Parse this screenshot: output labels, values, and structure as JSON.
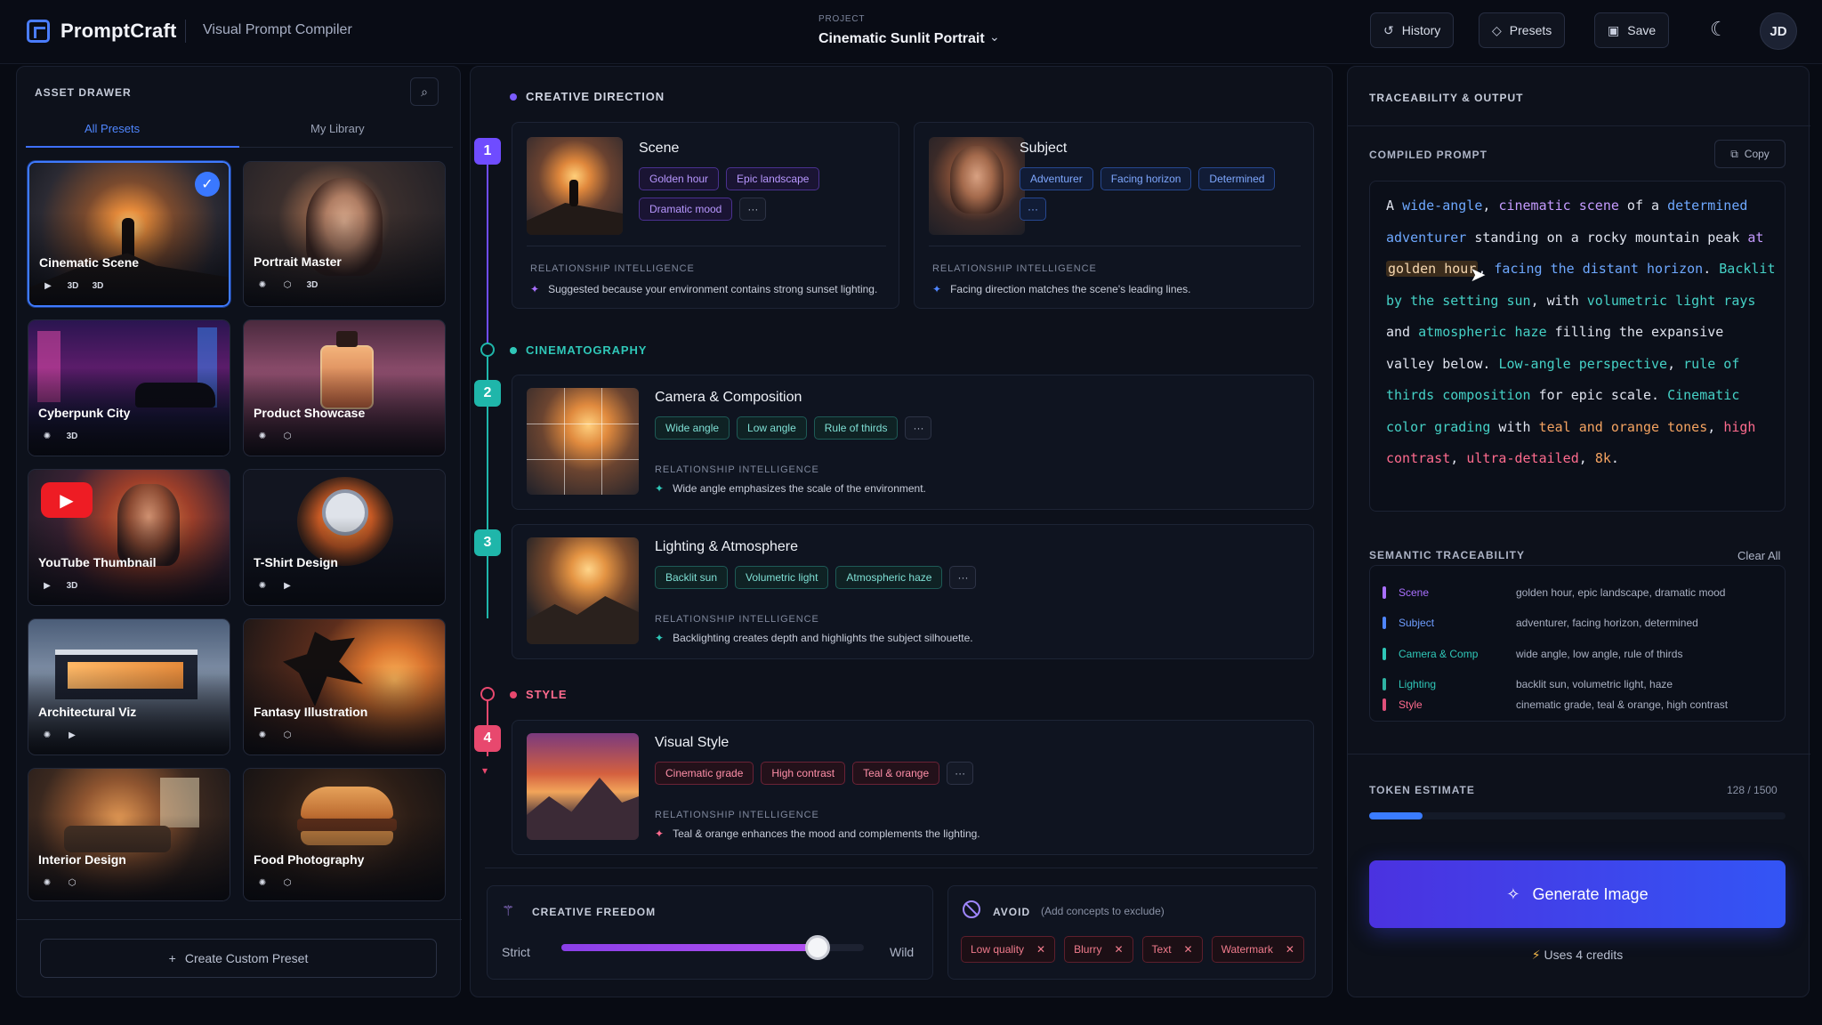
{
  "header": {
    "brand": "PromptCraft",
    "subtitle": "Visual Prompt Compiler",
    "project_label": "PROJECT",
    "project_name": "Cinematic Sunlit Portrait",
    "history": "History",
    "presets": "Presets",
    "save": "Save",
    "avatar": "JD"
  },
  "drawer": {
    "title": "ASSET DRAWER",
    "tab_all": "All Presets",
    "tab_library": "My Library",
    "create": "Create Custom Preset",
    "cards": [
      {
        "label": "Cinematic Scene",
        "icons": [
          "video-icon",
          "3D",
          "3D"
        ],
        "selected": true
      },
      {
        "label": "Portrait Master",
        "icons": [
          "aperture-icon",
          "cube-icon",
          "3D"
        ]
      },
      {
        "label": "Cyberpunk City",
        "icons": [
          "aperture-icon",
          "3D"
        ]
      },
      {
        "label": "Product Showcase",
        "icons": [
          "aperture-icon",
          "cube-icon"
        ]
      },
      {
        "label": "YouTube Thumbnail",
        "icons": [
          "video-icon",
          "3D"
        ]
      },
      {
        "label": "T-Shirt Design",
        "icons": [
          "aperture-icon",
          "video-icon"
        ]
      },
      {
        "label": "Architectural Viz",
        "icons": [
          "aperture-icon",
          "video-icon"
        ]
      },
      {
        "label": "Fantasy Illustration",
        "icons": [
          "aperture-icon",
          "cube-icon"
        ]
      },
      {
        "label": "Interior Design",
        "icons": [
          "aperture-icon",
          "cube-icon"
        ]
      },
      {
        "label": "Food Photography",
        "icons": [
          "aperture-icon",
          "cube-icon"
        ]
      }
    ]
  },
  "creative": {
    "title": "CREATIVE DIRECTION",
    "cinematography": "CINEMATOGRAPHY",
    "style_title": "STYLE",
    "rel_label": "RELATIONSHIP INTELLIGENCE",
    "scene": {
      "step": "1",
      "title": "Scene",
      "chips": [
        "Golden hour",
        "Epic landscape",
        "Dramatic mood",
        "···"
      ],
      "rel": "Suggested because your environment contains strong sunset lighting."
    },
    "subject": {
      "title": "Subject",
      "chips": [
        "Adventurer",
        "Facing horizon",
        "Determined",
        "···"
      ],
      "rel": "Facing direction matches the scene's leading lines."
    },
    "camera": {
      "step": "2",
      "title": "Camera & Composition",
      "chips": [
        "Wide angle",
        "Low angle",
        "Rule of thirds",
        "···"
      ],
      "rel": "Wide angle emphasizes the scale of the environment."
    },
    "lighting": {
      "step": "3",
      "title": "Lighting & Atmosphere",
      "chips": [
        "Backlit sun",
        "Volumetric light",
        "Atmospheric haze",
        "···"
      ],
      "rel": "Backlighting creates depth and highlights the subject silhouette."
    },
    "style": {
      "step": "4",
      "title": "Visual Style",
      "chips": [
        "Cinematic grade",
        "High contrast",
        "Teal & orange",
        "···"
      ],
      "rel": "Teal & orange enhances the mood and complements the lighting."
    }
  },
  "freedom": {
    "title": "CREATIVE FREEDOM",
    "left": "Strict",
    "right": "Wild",
    "value": 0.85
  },
  "avoid": {
    "title": "AVOID",
    "hint": "(Add concepts to exclude)",
    "chips": [
      "Low quality",
      "Blurry",
      "Text",
      "Watermark"
    ]
  },
  "output": {
    "title": "TRACEABILITY & OUTPUT",
    "compiled_label": "COMPILED PROMPT",
    "copy": "Copy",
    "trace_title": "SEMANTIC TRACEABILITY",
    "clear": "Clear All",
    "trace": [
      {
        "name": "Scene",
        "value": "golden hour, epic landscape, dramatic mood",
        "color": "#a970ff"
      },
      {
        "name": "Subject",
        "value": "adventurer, facing horizon, determined",
        "color": "#4f86ff"
      },
      {
        "name": "Camera & Comp",
        "value": "wide angle, low angle, rule of thirds",
        "color": "#2fc7b8"
      },
      {
        "name": "Lighting",
        "value": "backlit sun, volumetric light, haze",
        "color": "#2fb3a3"
      },
      {
        "name": "Style",
        "value": "cinematic grade, teal & orange, high contrast",
        "color": "#e0507a"
      }
    ],
    "token_label": "TOKEN ESTIMATE",
    "token_value": "128 / 1500",
    "generate": "Generate Image",
    "credits": "Uses 4 credits"
  }
}
